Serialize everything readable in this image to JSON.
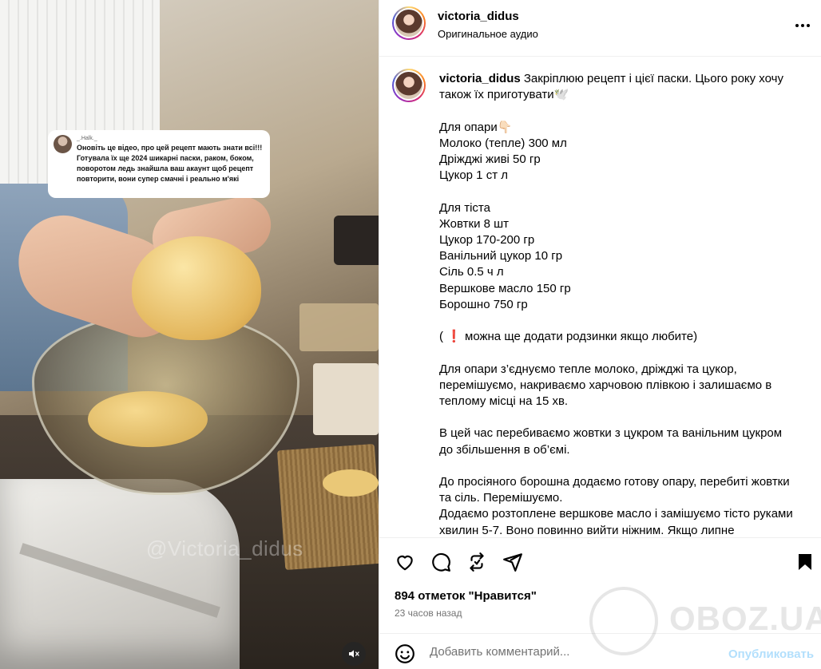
{
  "media": {
    "comment_card": {
      "username": "_.Halk._",
      "text": "Оновіть це відео, про цей рецепт мають знати всі!!! Готувала їх ще 2024 шикарні паски, раком, боком, поворотом ледь знайшла ваш акаунт щоб рецепт повторити, вони супер смачні і реально м'які"
    },
    "watermark": "@Victoria_didus",
    "mute_icon": "speaker-muted-icon"
  },
  "header": {
    "username": "victoria_didus",
    "audio": "Оригинальное аудио",
    "more_icon": "more-options-icon"
  },
  "caption": {
    "username": "victoria_didus",
    "text": " Закріплюю рецепт і цієї паски. Цього року хочу також їх приготувати🕊️\n\nДля опари👇🏻\nМолоко (тепле) 300 мл\nДріжджі живі 50 гр\nЦукор 1 ст л\n\nДля тіста\nЖовтки 8 шт\nЦукор 170-200 гр\nВанільний цукор 10 гр\nСіль 0.5 ч л\nВершкове масло 150 гр\nБорошно 750 гр\n\n( ❗ можна ще додати родзинки якщо любите)\n\nДля опари з’єднуємо тепле молоко, дріжджі та цукор, перемішуємо, накриваємо харчовою плівкою і залишаємо в теплому місці на 15 хв.\n\nВ цей час перебиваємо жовтки з цукром та ванільним цукром до збільшення в об’ємі.\n\nДо просіяного борошна додаємо готову опару, перебиті жовтки та сіль. Перемішуємо.\nДодаємо розтоплене вершкове масло і замішуємо тісто руками хвилин 5-7. Воно повинно вийти ніжним. Якщо липне"
  },
  "actions": {
    "like_icon": "heart-icon",
    "comment_icon": "comment-icon",
    "share_icon": "repost-icon",
    "send_icon": "send-icon",
    "save_icon": "bookmark-icon",
    "likes_text": "894 отметок \"Нравится\"",
    "time_text": "23 часов назад"
  },
  "comment_bar": {
    "emoji_icon": "emoji-icon",
    "placeholder": "Добавить комментарий...",
    "post_label": "Опубликовать"
  },
  "overlay": {
    "logo_text": "OBOZ.UA"
  }
}
